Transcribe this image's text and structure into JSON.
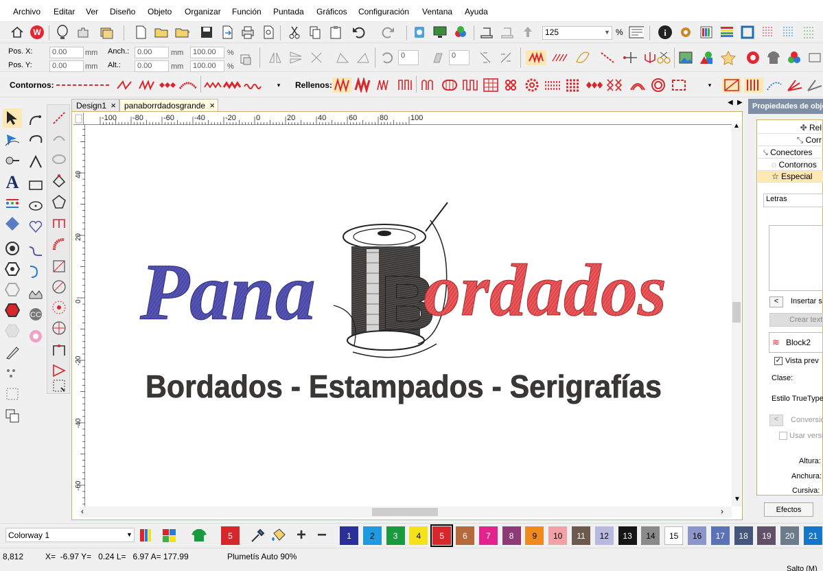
{
  "menu": [
    "Archivo",
    "Editar",
    "Ver",
    "Diseño",
    "Objeto",
    "Organizar",
    "Función",
    "Puntada",
    "Gráficos",
    "Configuración",
    "Ventana",
    "Ayuda"
  ],
  "toolbar1": {
    "zoom_value": "125",
    "zoom_unit": "%"
  },
  "toolbar2": {
    "pos_x_label": "Pos. X:",
    "pos_y_label": "Pos. Y:",
    "pos_x": "0.00",
    "pos_y": "0.00",
    "anch_label": "Anch.:",
    "alt_label": "Alt.:",
    "anch": "0.00",
    "alt": "0.00",
    "unit_mm": "mm",
    "pct_w": "100.00",
    "pct_h": "100.00",
    "pct": "%",
    "rot_value": "0",
    "slant_value": "0"
  },
  "toolbar3": {
    "contornos_label": "Contornos:",
    "rellenos_label": "Rellenos:"
  },
  "tabs": [
    "Design1",
    "panaborrdadosgrande"
  ],
  "ruler": {
    "h_ticks": [
      "-100",
      "-80",
      "-60",
      "-40",
      "-20",
      "0",
      "20",
      "40",
      "60",
      "80",
      "100"
    ],
    "v_ticks": [
      "40",
      "20",
      "0",
      "-20",
      "-40",
      "-60"
    ]
  },
  "design": {
    "word_left": "Pana",
    "word_right": "ordados",
    "spool_letter": "B",
    "tagline": "Bordados - Estampados - Serigrafías",
    "colors": {
      "blue": "#4b4aa6",
      "red": "#e0474a",
      "dark": "#3a3836"
    }
  },
  "right_panel": {
    "title": "Propiedades de objeto",
    "items": [
      "Rel",
      "Corr",
      "Conectores",
      "Contornos",
      "Especial"
    ],
    "letras": "Letras",
    "insert_label": "Insertar s",
    "create_label": "Crear text",
    "font_name": "Block2",
    "preview_label": "Vista prev",
    "clase_label": "Clase:",
    "estilo_label": "Estilo TrueType",
    "conversion_label": "Conversió",
    "usar_label": "Usar versi",
    "altura_label": "Altura:",
    "anchura_label": "Anchura:",
    "cursiva_label": "Cursiva:",
    "efectos_label": "Efectos"
  },
  "colorbar": {
    "colorway": "Colorway 1",
    "current_color": "5",
    "palette": [
      {
        "n": "1",
        "c": "#2b2f9a",
        "t": "#fff"
      },
      {
        "n": "2",
        "c": "#1e9be0",
        "t": "#000"
      },
      {
        "n": "3",
        "c": "#1a9a3e",
        "t": "#fff"
      },
      {
        "n": "4",
        "c": "#f4e21a",
        "t": "#000"
      },
      {
        "n": "5",
        "c": "#d7262c",
        "t": "#fff"
      },
      {
        "n": "6",
        "c": "#b66a3c",
        "t": "#fff"
      },
      {
        "n": "7",
        "c": "#e3238d",
        "t": "#fff"
      },
      {
        "n": "8",
        "c": "#8f3a74",
        "t": "#fff"
      },
      {
        "n": "9",
        "c": "#ef8a1e",
        "t": "#000"
      },
      {
        "n": "10",
        "c": "#f2a1a6",
        "t": "#000"
      },
      {
        "n": "11",
        "c": "#6c5a4f",
        "t": "#fff"
      },
      {
        "n": "12",
        "c": "#b7b9de",
        "t": "#000"
      },
      {
        "n": "13",
        "c": "#151515",
        "t": "#fff"
      },
      {
        "n": "14",
        "c": "#8a8a8a",
        "t": "#000"
      },
      {
        "n": "15",
        "c": "#ffffff",
        "t": "#000"
      },
      {
        "n": "16",
        "c": "#8d96c8",
        "t": "#000"
      },
      {
        "n": "17",
        "c": "#5b72b6",
        "t": "#fff"
      },
      {
        "n": "18",
        "c": "#45557c",
        "t": "#fff"
      },
      {
        "n": "19",
        "c": "#62506a",
        "t": "#fff"
      },
      {
        "n": "20",
        "c": "#6c7c8c",
        "t": "#fff"
      },
      {
        "n": "21",
        "c": "#1476c8",
        "t": "#fff"
      }
    ]
  },
  "status": {
    "coords_left": "8,812",
    "measure": "X=  -6.97 Y=   0.24 L=   6.97 A= 177.99",
    "stitch_info": "Plumetís Auto 90%",
    "right_text": "Salto (M)"
  }
}
